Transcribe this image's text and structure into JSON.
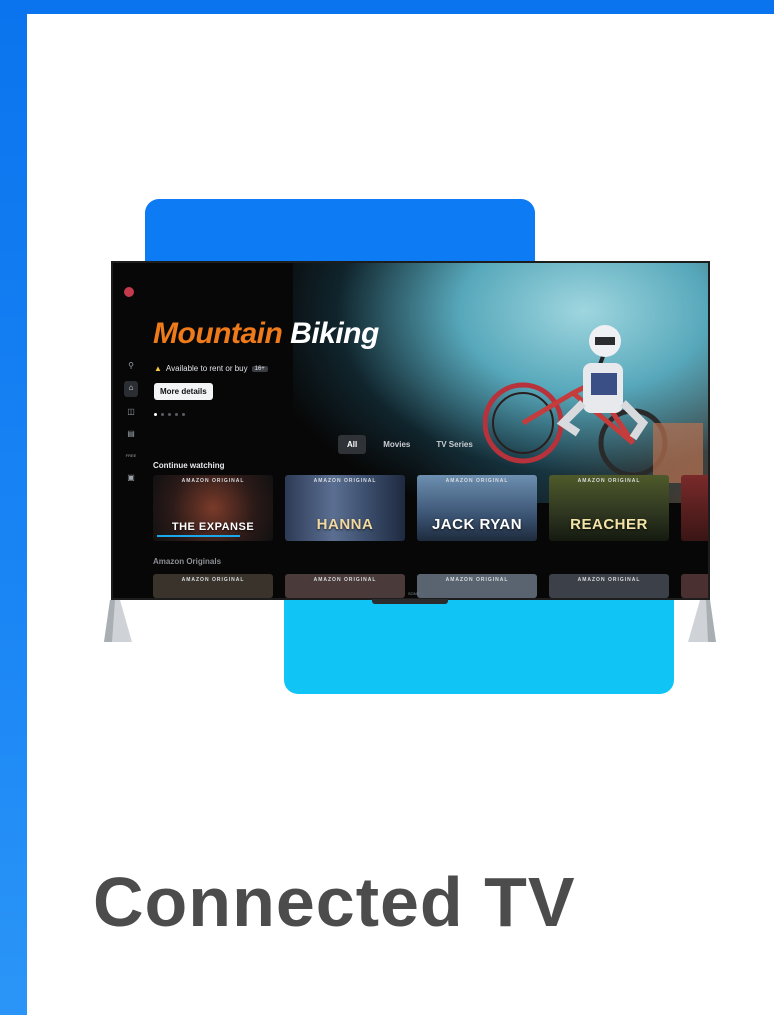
{
  "colors": {
    "frame_blue": "#0a74ee",
    "deco_blue": "#0d7bf3",
    "deco_cyan": "#10c5f6",
    "title_orange": "#ef7a1a",
    "caption_gray": "#4c4c4c"
  },
  "tv": {
    "sidebar": {
      "icons": [
        "search-icon",
        "home-icon",
        "store-icon",
        "library-icon",
        "free-icon",
        "live-tv-icon"
      ],
      "free_label": "FREE"
    },
    "hero": {
      "title_part1": "Mountain",
      "title_part2": "Biking",
      "availability": "Available to rent or buy",
      "rating": "16+",
      "details_button": "More details",
      "carousel_pages": 5,
      "carousel_active": 1
    },
    "tabs": [
      {
        "label": "All",
        "selected": true
      },
      {
        "label": "Movies",
        "selected": false
      },
      {
        "label": "TV Series",
        "selected": false
      }
    ],
    "continue_watching": {
      "label": "Continue watching",
      "items": [
        {
          "badge": "AMAZON ORIGINAL",
          "name": "THE EXPANSE",
          "progress": 0.75
        },
        {
          "badge": "AMAZON ORIGINAL",
          "name": "HANNA"
        },
        {
          "badge": "AMAZON ORIGINAL",
          "name": "JACK RYAN"
        },
        {
          "badge": "AMAZON ORIGINAL",
          "name": "REACHER"
        }
      ]
    },
    "originals": {
      "label": "Amazon Originals",
      "badges": [
        "AMAZON ORIGINAL",
        "AMAZON ORIGINAL",
        "AMAZON ORIGINAL",
        "AMAZON ORIGINAL"
      ]
    },
    "brand": "SONY"
  },
  "caption": "Connected TV"
}
